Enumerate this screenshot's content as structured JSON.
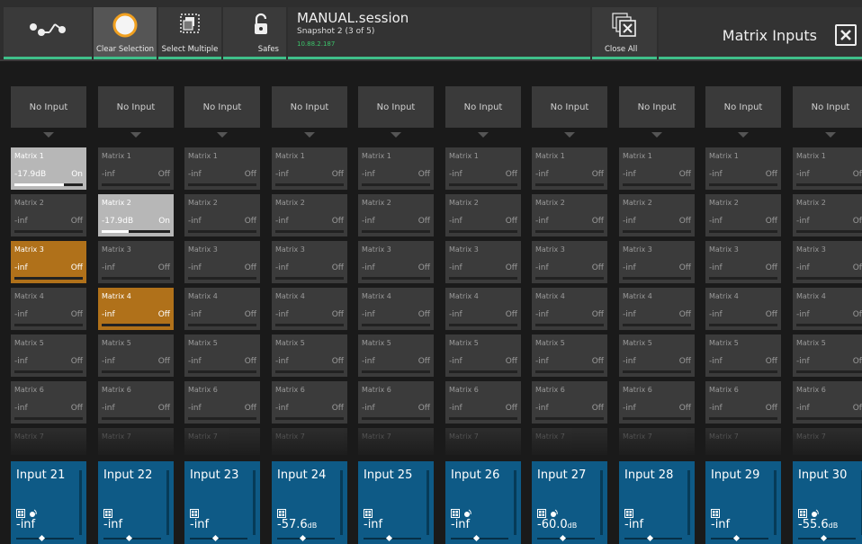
{
  "toolbar": {
    "clear_selection": "Clear Selection",
    "select_multiple": "Select Multiple",
    "safes": "Safes",
    "close_all": "Close All"
  },
  "session": {
    "name": "MANUAL.session",
    "snapshot": "Snapshot 2 (3 of 5)",
    "ip": "10.88.2.187"
  },
  "panel_title": "Matrix Inputs",
  "colors": {
    "accent": "#3fbf8a",
    "input_blue": "#0e5a86",
    "selected_orange": "#b0711a",
    "on_grey": "#b7b7b7"
  },
  "columns": [
    {
      "source": "No Input",
      "input": "Input 21",
      "value": "-inf",
      "unit": "",
      "icons": [
        "grid-icon",
        "speaker-icon"
      ],
      "fader": 0.45,
      "cells": [
        {
          "name": "Matrix 1",
          "value": "-17.9dB",
          "status": "On",
          "state": "on",
          "level": 0.72
        },
        {
          "name": "Matrix 2",
          "value": "-inf",
          "status": "Off",
          "state": "off",
          "level": 0
        },
        {
          "name": "Matrix 3",
          "value": "-inf",
          "status": "Off",
          "state": "sel",
          "level": 0
        },
        {
          "name": "Matrix 4",
          "value": "-inf",
          "status": "Off",
          "state": "off",
          "level": 0
        },
        {
          "name": "Matrix 5",
          "value": "-inf",
          "status": "Off",
          "state": "off",
          "level": 0
        },
        {
          "name": "Matrix 6",
          "value": "-inf",
          "status": "Off",
          "state": "off",
          "level": 0
        },
        {
          "name": "Matrix 7",
          "value": "",
          "status": "",
          "state": "fade",
          "level": 0
        }
      ]
    },
    {
      "source": "No Input",
      "input": "Input 22",
      "value": "-inf",
      "unit": "",
      "icons": [
        "grid-icon"
      ],
      "fader": 0.45,
      "cells": [
        {
          "name": "Matrix 1",
          "value": "-inf",
          "status": "Off",
          "state": "off",
          "level": 0
        },
        {
          "name": "Matrix 2",
          "value": "-17.9dB",
          "status": "On",
          "state": "on",
          "level": 0.4
        },
        {
          "name": "Matrix 3",
          "value": "-inf",
          "status": "Off",
          "state": "off",
          "level": 0
        },
        {
          "name": "Matrix 4",
          "value": "-inf",
          "status": "Off",
          "state": "sel",
          "level": 0
        },
        {
          "name": "Matrix 5",
          "value": "-inf",
          "status": "Off",
          "state": "off",
          "level": 0
        },
        {
          "name": "Matrix 6",
          "value": "-inf",
          "status": "Off",
          "state": "off",
          "level": 0
        },
        {
          "name": "Matrix 7",
          "value": "",
          "status": "",
          "state": "fade",
          "level": 0
        }
      ]
    },
    {
      "source": "No Input",
      "input": "Input 23",
      "value": "-inf",
      "unit": "",
      "icons": [
        "grid-icon"
      ],
      "fader": 0.45,
      "cells": [
        {
          "name": "Matrix 1",
          "value": "-inf",
          "status": "Off",
          "state": "off",
          "level": 0
        },
        {
          "name": "Matrix 2",
          "value": "-inf",
          "status": "Off",
          "state": "off",
          "level": 0
        },
        {
          "name": "Matrix 3",
          "value": "-inf",
          "status": "Off",
          "state": "off",
          "level": 0
        },
        {
          "name": "Matrix 4",
          "value": "-inf",
          "status": "Off",
          "state": "off",
          "level": 0
        },
        {
          "name": "Matrix 5",
          "value": "-inf",
          "status": "Off",
          "state": "off",
          "level": 0
        },
        {
          "name": "Matrix 6",
          "value": "-inf",
          "status": "Off",
          "state": "off",
          "level": 0
        },
        {
          "name": "Matrix 7",
          "value": "",
          "status": "",
          "state": "fade",
          "level": 0
        }
      ]
    },
    {
      "source": "No Input",
      "input": "Input 24",
      "value": "-57.6",
      "unit": "dB",
      "icons": [
        "grid-icon"
      ],
      "fader": 0.45,
      "cells": [
        {
          "name": "Matrix 1",
          "value": "-inf",
          "status": "Off",
          "state": "off",
          "level": 0
        },
        {
          "name": "Matrix 2",
          "value": "-inf",
          "status": "Off",
          "state": "off",
          "level": 0
        },
        {
          "name": "Matrix 3",
          "value": "-inf",
          "status": "Off",
          "state": "off",
          "level": 0
        },
        {
          "name": "Matrix 4",
          "value": "-inf",
          "status": "Off",
          "state": "off",
          "level": 0
        },
        {
          "name": "Matrix 5",
          "value": "-inf",
          "status": "Off",
          "state": "off",
          "level": 0
        },
        {
          "name": "Matrix 6",
          "value": "-inf",
          "status": "Off",
          "state": "off",
          "level": 0
        },
        {
          "name": "Matrix 7",
          "value": "",
          "status": "",
          "state": "fade",
          "level": 0
        }
      ]
    },
    {
      "source": "No Input",
      "input": "Input 25",
      "value": "-inf",
      "unit": "",
      "icons": [
        "grid-icon"
      ],
      "fader": 0.45,
      "cells": [
        {
          "name": "Matrix 1",
          "value": "-inf",
          "status": "Off",
          "state": "off",
          "level": 0
        },
        {
          "name": "Matrix 2",
          "value": "-inf",
          "status": "Off",
          "state": "off",
          "level": 0
        },
        {
          "name": "Matrix 3",
          "value": "-inf",
          "status": "Off",
          "state": "off",
          "level": 0
        },
        {
          "name": "Matrix 4",
          "value": "-inf",
          "status": "Off",
          "state": "off",
          "level": 0
        },
        {
          "name": "Matrix 5",
          "value": "-inf",
          "status": "Off",
          "state": "off",
          "level": 0
        },
        {
          "name": "Matrix 6",
          "value": "-inf",
          "status": "Off",
          "state": "off",
          "level": 0
        },
        {
          "name": "Matrix 7",
          "value": "",
          "status": "",
          "state": "fade",
          "level": 0
        }
      ]
    },
    {
      "source": "No Input",
      "input": "Input 26",
      "value": "-inf",
      "unit": "",
      "icons": [
        "grid-icon",
        "speaker-icon"
      ],
      "fader": 0.45,
      "cells": [
        {
          "name": "Matrix 1",
          "value": "-inf",
          "status": "Off",
          "state": "off",
          "level": 0
        },
        {
          "name": "Matrix 2",
          "value": "-inf",
          "status": "Off",
          "state": "off",
          "level": 0
        },
        {
          "name": "Matrix 3",
          "value": "-inf",
          "status": "Off",
          "state": "off",
          "level": 0
        },
        {
          "name": "Matrix 4",
          "value": "-inf",
          "status": "Off",
          "state": "off",
          "level": 0
        },
        {
          "name": "Matrix 5",
          "value": "-inf",
          "status": "Off",
          "state": "off",
          "level": 0
        },
        {
          "name": "Matrix 6",
          "value": "-inf",
          "status": "Off",
          "state": "off",
          "level": 0
        },
        {
          "name": "Matrix 7",
          "value": "",
          "status": "",
          "state": "fade",
          "level": 0
        }
      ]
    },
    {
      "source": "No Input",
      "input": "Input 27",
      "value": "-60.0",
      "unit": "dB",
      "icons": [
        "grid-icon",
        "speaker-icon"
      ],
      "fader": 0.45,
      "cells": [
        {
          "name": "Matrix 1",
          "value": "-inf",
          "status": "Off",
          "state": "off",
          "level": 0
        },
        {
          "name": "Matrix 2",
          "value": "-inf",
          "status": "Off",
          "state": "off",
          "level": 0
        },
        {
          "name": "Matrix 3",
          "value": "-inf",
          "status": "Off",
          "state": "off",
          "level": 0
        },
        {
          "name": "Matrix 4",
          "value": "-inf",
          "status": "Off",
          "state": "off",
          "level": 0
        },
        {
          "name": "Matrix 5",
          "value": "-inf",
          "status": "Off",
          "state": "off",
          "level": 0
        },
        {
          "name": "Matrix 6",
          "value": "-inf",
          "status": "Off",
          "state": "off",
          "level": 0
        },
        {
          "name": "Matrix 7",
          "value": "",
          "status": "",
          "state": "fade",
          "level": 0
        }
      ]
    },
    {
      "source": "No Input",
      "input": "Input 28",
      "value": "-inf",
      "unit": "",
      "icons": [
        "grid-icon"
      ],
      "fader": 0.45,
      "cells": [
        {
          "name": "Matrix 1",
          "value": "-inf",
          "status": "Off",
          "state": "off",
          "level": 0
        },
        {
          "name": "Matrix 2",
          "value": "-inf",
          "status": "Off",
          "state": "off",
          "level": 0
        },
        {
          "name": "Matrix 3",
          "value": "-inf",
          "status": "Off",
          "state": "off",
          "level": 0
        },
        {
          "name": "Matrix 4",
          "value": "-inf",
          "status": "Off",
          "state": "off",
          "level": 0
        },
        {
          "name": "Matrix 5",
          "value": "-inf",
          "status": "Off",
          "state": "off",
          "level": 0
        },
        {
          "name": "Matrix 6",
          "value": "-inf",
          "status": "Off",
          "state": "off",
          "level": 0
        },
        {
          "name": "Matrix 7",
          "value": "",
          "status": "",
          "state": "fade",
          "level": 0
        }
      ]
    },
    {
      "source": "No Input",
      "input": "Input 29",
      "value": "-inf",
      "unit": "",
      "icons": [
        "grid-icon"
      ],
      "fader": 0.45,
      "cells": [
        {
          "name": "Matrix 1",
          "value": "-inf",
          "status": "Off",
          "state": "off",
          "level": 0
        },
        {
          "name": "Matrix 2",
          "value": "-inf",
          "status": "Off",
          "state": "off",
          "level": 0
        },
        {
          "name": "Matrix 3",
          "value": "-inf",
          "status": "Off",
          "state": "off",
          "level": 0
        },
        {
          "name": "Matrix 4",
          "value": "-inf",
          "status": "Off",
          "state": "off",
          "level": 0
        },
        {
          "name": "Matrix 5",
          "value": "-inf",
          "status": "Off",
          "state": "off",
          "level": 0
        },
        {
          "name": "Matrix 6",
          "value": "-inf",
          "status": "Off",
          "state": "off",
          "level": 0
        },
        {
          "name": "Matrix 7",
          "value": "",
          "status": "",
          "state": "fade",
          "level": 0
        }
      ]
    },
    {
      "source": "No Input",
      "input": "Input 30",
      "value": "-55.6",
      "unit": "dB",
      "icons": [
        "grid-icon",
        "speaker-icon"
      ],
      "fader": 0.45,
      "cells": [
        {
          "name": "Matrix 1",
          "value": "-inf",
          "status": "Off",
          "state": "off",
          "level": 0
        },
        {
          "name": "Matrix 2",
          "value": "-inf",
          "status": "Off",
          "state": "off",
          "level": 0
        },
        {
          "name": "Matrix 3",
          "value": "-inf",
          "status": "Off",
          "state": "off",
          "level": 0
        },
        {
          "name": "Matrix 4",
          "value": "-inf",
          "status": "Off",
          "state": "off",
          "level": 0
        },
        {
          "name": "Matrix 5",
          "value": "-inf",
          "status": "Off",
          "state": "off",
          "level": 0
        },
        {
          "name": "Matrix 6",
          "value": "-inf",
          "status": "Off",
          "state": "off",
          "level": 0
        },
        {
          "name": "Matrix 7",
          "value": "",
          "status": "",
          "state": "fade",
          "level": 0
        }
      ]
    }
  ]
}
